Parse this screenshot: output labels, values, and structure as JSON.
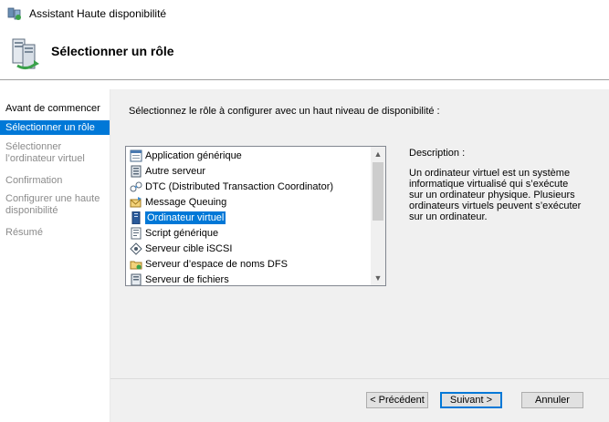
{
  "window": {
    "title": "Assistant Haute disponibilité"
  },
  "header": {
    "title": "Sélectionner un rôle"
  },
  "sidebar": {
    "steps": [
      {
        "label": "Avant de commencer",
        "state": "done"
      },
      {
        "label": "Sélectionner un rôle",
        "state": "active"
      },
      {
        "label": "Sélectionner l’ordinateur virtuel",
        "state": "disabled"
      },
      {
        "label": "Confirmation",
        "state": "disabled"
      },
      {
        "label": "Configurer une haute disponibilité",
        "state": "disabled"
      },
      {
        "label": "Résumé",
        "state": "disabled"
      }
    ]
  },
  "main": {
    "instruction": "Sélectionnez le rôle à configurer avec un haut niveau de disponibilité :",
    "roles": [
      {
        "label": "Application générique",
        "icon": "application-icon"
      },
      {
        "label": "Autre serveur",
        "icon": "server-icon"
      },
      {
        "label": "DTC (Distributed Transaction Coordinator)",
        "icon": "dtc-icon"
      },
      {
        "label": "Message Queuing",
        "icon": "message-queuing-icon"
      },
      {
        "label": "Ordinateur virtuel",
        "icon": "virtual-machine-icon",
        "selected": true
      },
      {
        "label": "Script générique",
        "icon": "script-icon"
      },
      {
        "label": "Serveur cible iSCSI",
        "icon": "iscsi-icon"
      },
      {
        "label": "Serveur d’espace de noms DFS",
        "icon": "dfs-folder-icon"
      },
      {
        "label": "Serveur de fichiers",
        "icon": "file-server-icon"
      }
    ],
    "description_label": "Description :",
    "description_text": "Un ordinateur virtuel est un système informatique virtualisé qui s’exécute sur un ordinateur physique. Plusieurs ordinateurs virtuels peuvent s’exécuter sur un ordinateur."
  },
  "footer": {
    "previous_label": "< Précédent",
    "next_label": "Suivant >",
    "cancel_label": "Annuler"
  },
  "colors": {
    "accent": "#0078d7",
    "panel": "#f0f0f0",
    "disabled_text": "#8b8b8b"
  }
}
